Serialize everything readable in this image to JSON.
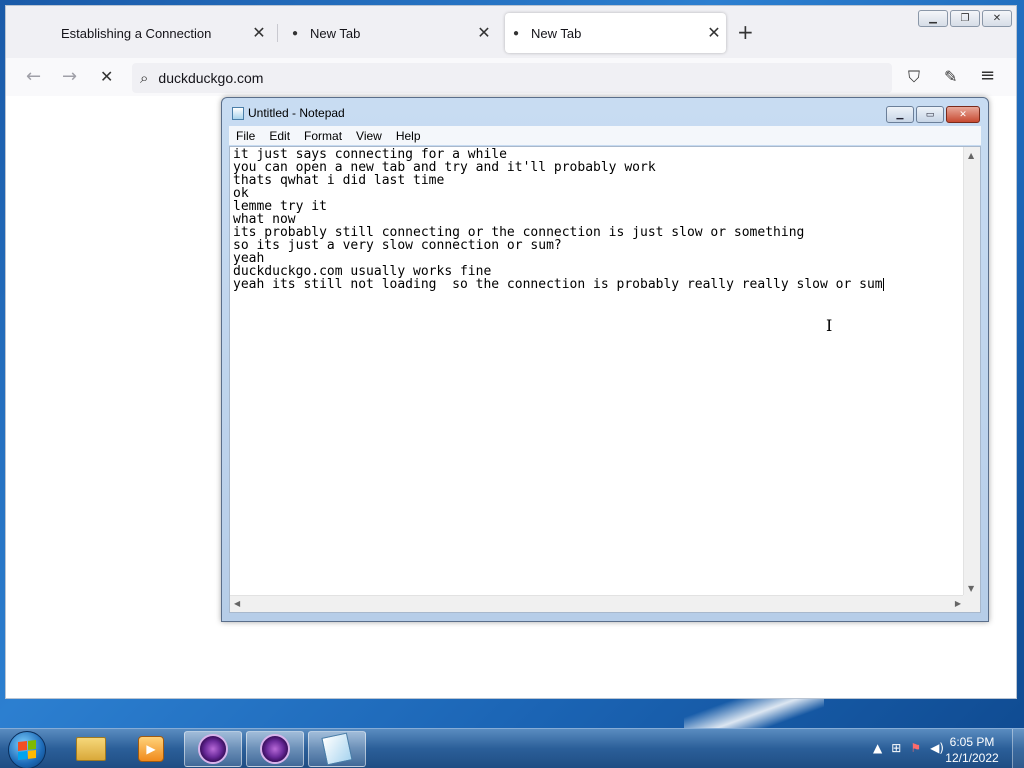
{
  "browser": {
    "tabs": [
      {
        "label": "Establishing a Connection",
        "has_dot": false,
        "active": false
      },
      {
        "label": "New Tab",
        "has_dot": true,
        "active": false
      },
      {
        "label": "New Tab",
        "has_dot": true,
        "active": true
      }
    ],
    "close_glyph": "✕",
    "dot_glyph": "●",
    "new_tab_glyph": "+",
    "window_controls": {
      "minimize": "▁",
      "maximize": "❐",
      "close": "✕"
    },
    "toolbar": {
      "back_glyph": "←",
      "forward_glyph": "→",
      "stop_glyph": "✕",
      "search_glyph": "⌕",
      "url": "duckduckgo.com",
      "shield_glyph": "⛉",
      "extensions_glyph": "✎",
      "menu_glyph": "≡"
    }
  },
  "notepad": {
    "title": "Untitled - Notepad",
    "controls": {
      "minimize": "▁",
      "maximize": "▭",
      "close": "✕"
    },
    "menu": [
      "File",
      "Edit",
      "Format",
      "View",
      "Help"
    ],
    "lines": [
      "it just says connecting for a while",
      "you can open a new tab and try and it'll probably work",
      "thats qwhat i did last time",
      "ok",
      "lemme try it",
      "what now",
      "its probably still connecting or the connection is just slow or something",
      "so its just a very slow connection or sum?",
      "yeah",
      "duckduckgo.com usually works fine",
      "yeah its still not loading  so the connection is probably really really slow or sum"
    ],
    "scroll": {
      "up": "▲",
      "down": "▼",
      "left": "◀",
      "right": "▶"
    }
  },
  "taskbar": {
    "items": [
      "start-button",
      "file-explorer",
      "media-player",
      "tor-browser-1",
      "tor-browser-2",
      "notepad"
    ],
    "tray": {
      "arrow": "▲",
      "network": "⊞",
      "flag": "⚑",
      "volume": "◀)"
    },
    "clock": {
      "time": "6:05 PM",
      "date": "12/1/2022"
    }
  },
  "colors": {
    "desktop": "#2c7fd0",
    "taskbar": "#2b5f99",
    "browser_bg": "#f0f0f4",
    "notepad_frame": "#c8dcf2"
  }
}
